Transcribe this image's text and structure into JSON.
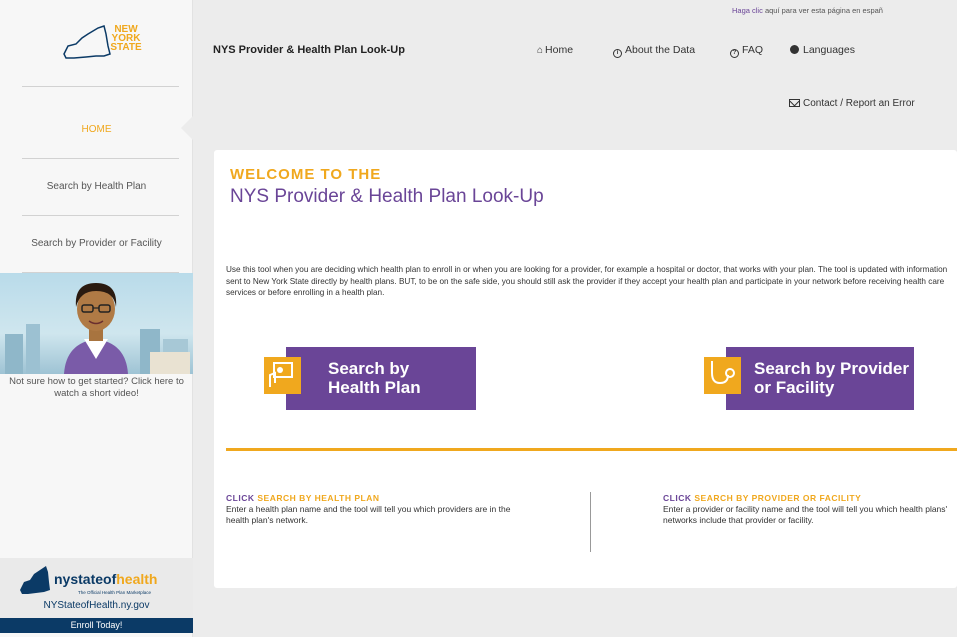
{
  "sidebar": {
    "logo_text": "NEW YORK STATE",
    "nav": {
      "home": "HOME",
      "health_plan": "Search by Health Plan",
      "provider": "Search by Provider or Facility"
    },
    "video_caption": "Not sure how to get started? Click here to watch a short video!",
    "brand": {
      "name_prefix": "nystateof",
      "name_suffix": "health",
      "tagline": "The Official Health Plan Marketplace",
      "url": "NYStateofHealth.ny.gov",
      "enroll": "Enroll Today!"
    }
  },
  "header": {
    "spanish_link": "Haga clic",
    "spanish_rest": "aquí para ver esta página en españ",
    "title": "NYS Provider & Health Plan Look-Up",
    "nav": {
      "home": "Home",
      "about": "About the Data",
      "faq": "FAQ",
      "languages": "Languages"
    },
    "contact": "Contact / Report an Error"
  },
  "main": {
    "welcome": "WELCOME TO THE",
    "heading": "NYS Provider & Health Plan Look-Up",
    "intro": "Use this tool when you are deciding which health plan to enroll in or when you are looking for a provider, for example a hospital or doctor, that works with your plan. The tool is updated with information sent to New York State directly by health plans. BUT, to be on the safe side, you should still ask the provider if they accept your health plan and participate in your network before receiving health care services or before enrolling in a health plan.",
    "btn_plan": "Search by Health Plan",
    "btn_provider": "Search by Provider or Facility",
    "col1": {
      "click": "CLICK",
      "title": "SEARCH BY HEALTH PLAN",
      "text": "Enter a health plan name and the tool will tell you which providers are in the health plan's network."
    },
    "col2": {
      "click": "CLICK",
      "title": "SEARCH BY PROVIDER OR FACILITY",
      "text": "Enter a provider or facility name and the tool will tell you which health plans' networks include that provider or facility."
    }
  },
  "colors": {
    "purple": "#6a4597",
    "orange": "#f0a81e",
    "navy": "#0b3a66"
  }
}
